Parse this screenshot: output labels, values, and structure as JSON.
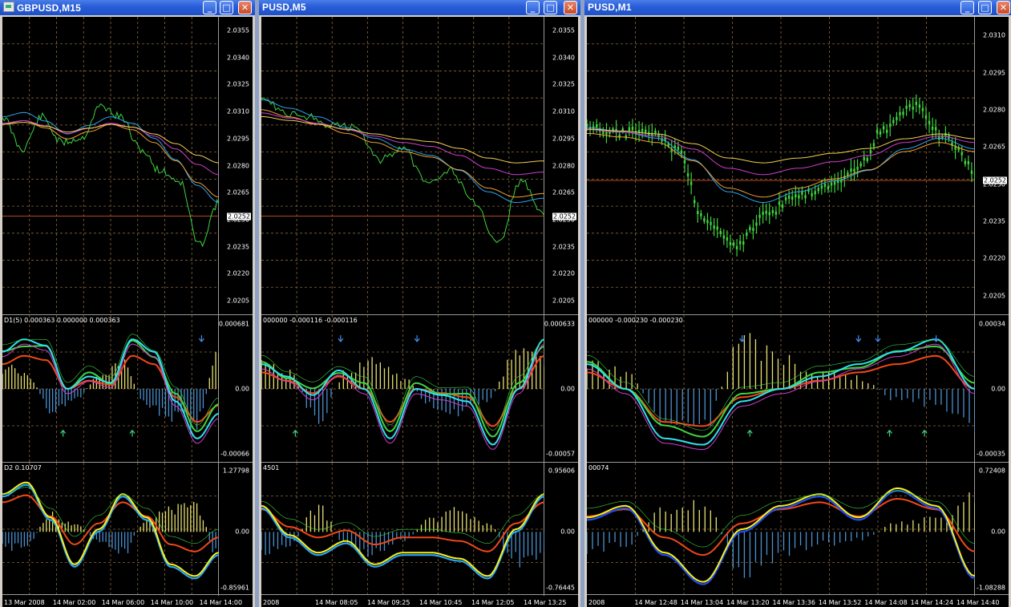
{
  "windows": [
    {
      "id": "w1",
      "title": "GBPUSD,M15",
      "last_price": "2.0252",
      "price_ticks": [
        "2.0355",
        "2.0340",
        "2.0325",
        "2.0310",
        "2.0295",
        "2.0280",
        "2.0265",
        "2.0250",
        "2.0235",
        "2.0220",
        "2.0205"
      ],
      "ind1": {
        "label": "D1(5) 0.000363 0.000000 0.000363",
        "ticks": [
          "0.000681",
          "0.00",
          "-0.00066"
        ]
      },
      "ind2": {
        "label": "D2 0.10707",
        "ticks": [
          "1.27798",
          "0.00",
          "-0.85961"
        ]
      },
      "time_labels": [
        "13 Mar 2008",
        "14 Mar 02:00",
        "14 Mar 06:00",
        "14 Mar 10:00",
        "14 Mar 14:00"
      ]
    },
    {
      "id": "w2",
      "title": "PUSD,M5",
      "last_price": "2.0252",
      "price_ticks": [
        "2.0355",
        "2.0340",
        "2.0325",
        "2.0310",
        "2.0295",
        "2.0280",
        "2.0265",
        "2.0250",
        "2.0235",
        "2.0220",
        "2.0205"
      ],
      "ind1": {
        "label": "000000 -0.000116 -0.000116",
        "ticks": [
          "0.000633",
          "0.00",
          "-0.00057"
        ]
      },
      "ind2": {
        "label": "4501",
        "ticks": [
          "0.95606",
          "0.00",
          "-0.76445"
        ]
      },
      "time_labels": [
        "2008",
        "14 Mar 08:05",
        "14 Mar 09:25",
        "14 Mar 10:45",
        "14 Mar 12:05",
        "14 Mar 13:25"
      ]
    },
    {
      "id": "w3",
      "title": "PUSD,M1",
      "last_price": "2.0252",
      "price_ticks": [
        "2.0310",
        "2.0295",
        "2.0280",
        "2.0265",
        "2.0250",
        "2.0235",
        "2.0220",
        "2.0205"
      ],
      "ind1": {
        "label": "000000 -0.000230 -0.000230",
        "ticks": [
          "0.00034",
          "0.00",
          "-0.00035"
        ]
      },
      "ind2": {
        "label": "00074",
        "ticks": [
          "0.72408",
          "0.00",
          "-1.08288"
        ]
      },
      "time_labels": [
        "2008",
        "14 Mar 12:48",
        "14 Mar 13:04",
        "14 Mar 13:20",
        "14 Mar 13:36",
        "14 Mar 13:52",
        "14 Mar 14:08",
        "14 Mar 14:24",
        "14 Mar 14:40"
      ]
    }
  ],
  "titlebar_buttons": {
    "minimize": "_",
    "maximize": "□",
    "close": "✕"
  },
  "colors": {
    "background": "#000000",
    "grid": "#8a6a3c",
    "price_line_green": "#3ed43e",
    "ma_blue": "#2ba5f0",
    "ma_magenta": "#d23cd2",
    "ma_orange": "#f0a030",
    "ma_yellow": "#f0d050",
    "hist_pos": "#e8e070",
    "hist_neg": "#4a90d0",
    "osc_red": "#f04818",
    "osc_cyan": "#30e0f0",
    "osc_yellow": "#f8f020",
    "osc_blue": "#2050f0",
    "arrow_up": "#40d080",
    "arrow_down": "#4090f0"
  }
}
